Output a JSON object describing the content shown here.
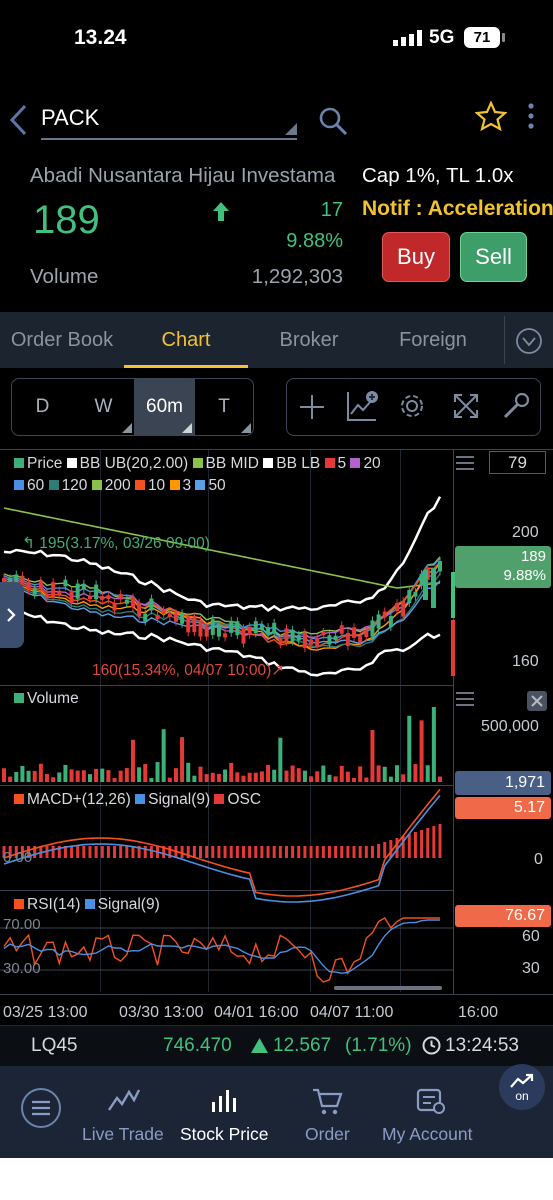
{
  "status_bar": {
    "time": "13.24",
    "network": "5G",
    "battery": "71"
  },
  "header": {
    "symbol": "PACK"
  },
  "stock": {
    "name": "Abadi Nusantara Hijau Investama",
    "cap_info": "Cap 1%, TL 1.0x",
    "price": "189",
    "change": "17",
    "change_pct": "9.88%",
    "notif": "Notif : Acceleration",
    "volume_label": "Volume",
    "volume": "1,292,303"
  },
  "actions": {
    "buy": "Buy",
    "sell": "Sell"
  },
  "tabs": [
    {
      "label": "Order Book"
    },
    {
      "label": "Chart",
      "active": true
    },
    {
      "label": "Broker"
    },
    {
      "label": "Foreign"
    }
  ],
  "timeframes": [
    {
      "label": "D"
    },
    {
      "label": "W"
    },
    {
      "label": "60m",
      "selected": true
    },
    {
      "label": "T"
    }
  ],
  "chart": {
    "field_value": "79",
    "price_legend_row1": [
      {
        "label": "Price",
        "color": "#3bb078"
      },
      {
        "label": "BB UB(20,2.00)",
        "color": "#ffffff"
      },
      {
        "label": "BB MID",
        "color": "#8bc34a"
      },
      {
        "label": "BB LB",
        "color": "#ffffff"
      },
      {
        "label": "5",
        "color": "#e53935"
      },
      {
        "label": "20",
        "color": "#b660cd"
      }
    ],
    "price_legend_row2": [
      {
        "label": "60",
        "color": "#4a90e2"
      },
      {
        "label": "120",
        "color": "#2e7d74"
      },
      {
        "label": "200",
        "color": "#8bc34a"
      },
      {
        "label": "10",
        "color": "#f4511e"
      },
      {
        "label": "3",
        "color": "#ff9800"
      },
      {
        "label": "50",
        "color": "#5aa0e6"
      }
    ],
    "high_annotation": "195(3.17%, 03/26 09:00)",
    "low_annotation": "160(15.34%, 04/07 10:00)",
    "price_axis": [
      "200",
      "160"
    ],
    "last_price": "189",
    "last_change_pct": "9.88%",
    "volume_legend": "Volume",
    "volume_axis": "500,000",
    "volume_last": "1,971",
    "macd_legend": [
      {
        "label": "MACD+(12,26)",
        "color": "#f4511e"
      },
      {
        "label": "Signal(9)",
        "color": "#4a90e2"
      },
      {
        "label": "OSC",
        "color": "#e53935"
      }
    ],
    "macd_last": "5.17",
    "macd_zero": "0.00",
    "macd_axis": "0",
    "rsi_legend": [
      {
        "label": "RSI(14)",
        "color": "#f4511e"
      },
      {
        "label": "Signal(9)",
        "color": "#4a90e2"
      }
    ],
    "rsi_last": "76.67",
    "rsi_levels": [
      "70.00",
      "30.00"
    ],
    "rsi_axis": [
      "60",
      "30"
    ],
    "time_axis": [
      "03/25 13:00",
      "03/30 13:00",
      "04/01 16:00",
      "04/07 11:00",
      "16:00"
    ]
  },
  "index_ticker": {
    "name": "LQ45",
    "value": "746.470",
    "change": "12.567",
    "change_pct": "(1.71%)",
    "time": "13:24:53"
  },
  "bottom_nav": [
    {
      "label": "Live Trade"
    },
    {
      "label": "Stock Price",
      "active": true
    },
    {
      "label": "Order"
    },
    {
      "label": "My Account"
    }
  ],
  "fab_label": "on"
}
